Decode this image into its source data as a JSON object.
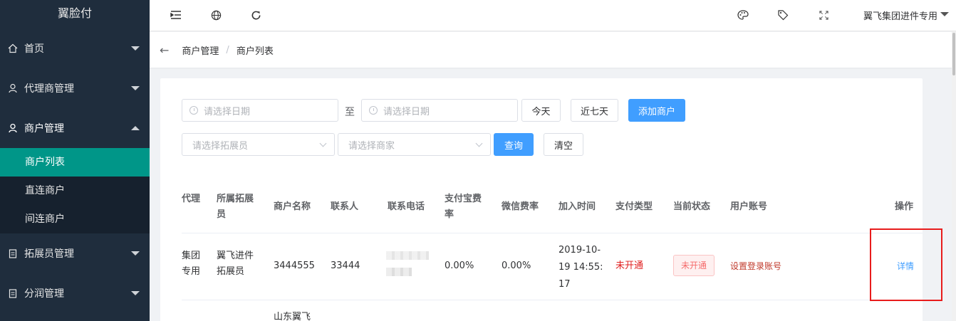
{
  "sidebar": {
    "brand": "翼脸付",
    "menu": [
      {
        "label": "首页",
        "icon": "home-icon"
      },
      {
        "label": "代理商管理",
        "icon": "user-icon"
      },
      {
        "label": "商户管理",
        "icon": "user-icon"
      },
      {
        "label": "拓展员管理",
        "icon": "clipboard-icon"
      },
      {
        "label": "分润管理",
        "icon": "clipboard-icon"
      }
    ],
    "submenu": [
      "商户列表",
      "直连商户",
      "间连商户"
    ]
  },
  "header": {
    "icons": [
      "menu-fold-icon",
      "globe-icon",
      "refresh-icon",
      "palette-icon",
      "tag-icon",
      "fullscreen-icon"
    ],
    "user": "翼飞集团进件专用"
  },
  "breadcrumb": {
    "items": [
      "商户管理",
      "商户列表"
    ],
    "separator": "/"
  },
  "filters": {
    "date_start_placeholder": "请选择日期",
    "to_label": "至",
    "date_end_placeholder": "请选择日期",
    "today_label": "今天",
    "last7_label": "近七天",
    "add_label": "添加商户",
    "promoter_placeholder": "请选择拓展员",
    "merchant_placeholder": "请选择商家",
    "query_label": "查询",
    "clear_label": "清空"
  },
  "table": {
    "headers": {
      "agent": "代理",
      "promoter_1": "所属拓展",
      "promoter_2": "员",
      "name": "商户名称",
      "contact": "联系人",
      "phone": "联系电话",
      "alipay_1": "支付宝费",
      "alipay_2": "率",
      "wechat": "微信费率",
      "joined": "加入时间",
      "paytype": "支付类型",
      "status": "当前状态",
      "account": "用户账号",
      "action": "操作"
    },
    "row1": {
      "agent_1": "集团",
      "agent_2": "专用",
      "promoter_1": "翼飞进件",
      "promoter_2": "拓展员",
      "name": "3444555",
      "contact": "33444",
      "alipay": "0.00%",
      "wechat": "0.00%",
      "joined_1": "2019-10-",
      "joined_2": "19 14:55:",
      "joined_3": "17",
      "paytype": "未开通",
      "status": "未开通",
      "account": "设置登录账号",
      "action": "详情"
    },
    "row2": {
      "name": "山东翼飞"
    }
  },
  "colors": {
    "sidebar_bg": "#1f2d3d",
    "active_item": "#009688",
    "primary": "#409eff",
    "danger": "#e02020",
    "highlight": "#e81c1c"
  }
}
